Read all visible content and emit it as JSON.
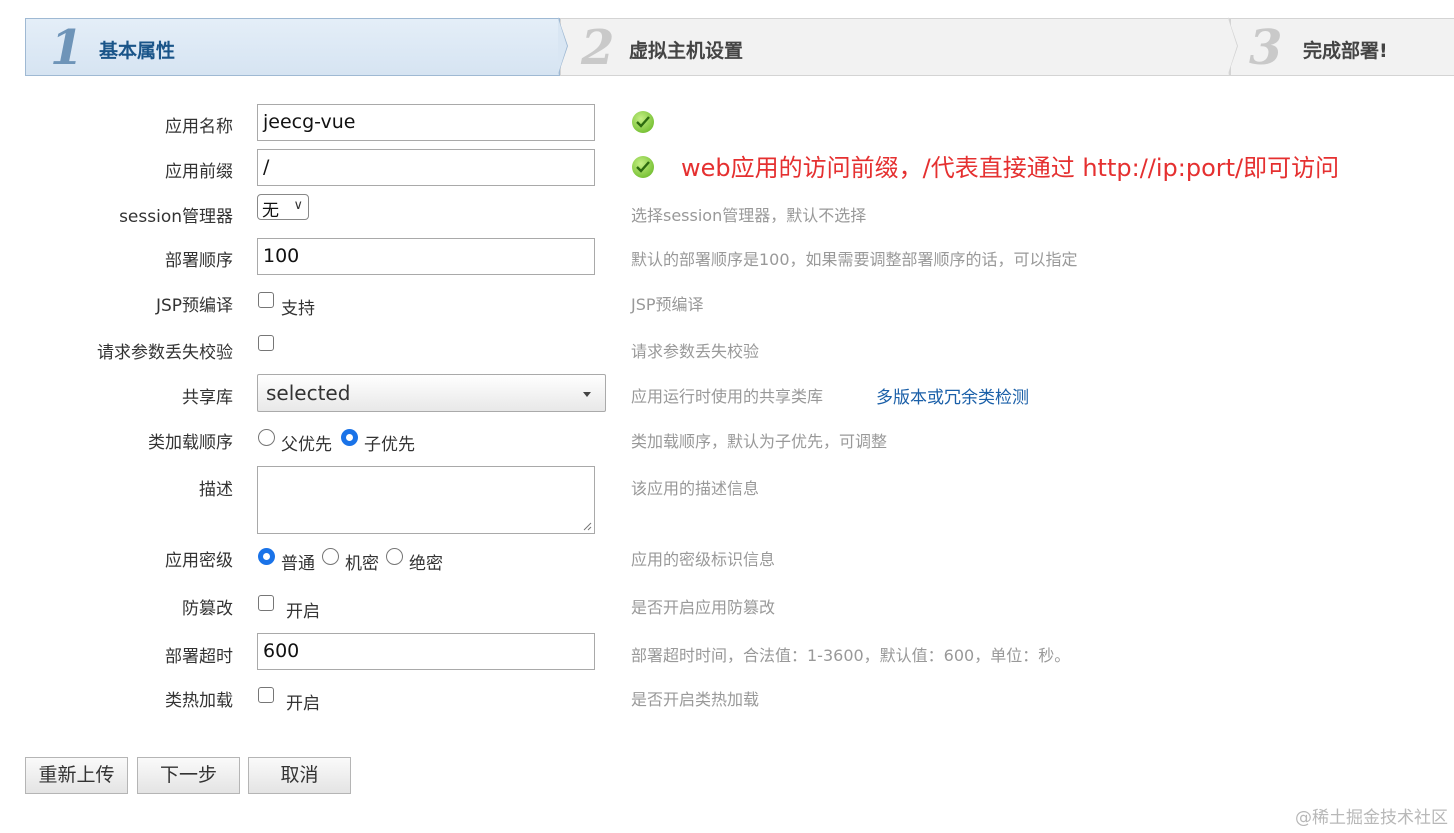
{
  "steps": [
    {
      "num": "1",
      "label": "基本属性"
    },
    {
      "num": "2",
      "label": "虚拟主机设置"
    },
    {
      "num": "3",
      "label": "完成部署!"
    }
  ],
  "form": {
    "app_name": {
      "label": "应用名称",
      "value": "jeecg-vue"
    },
    "app_prefix": {
      "label": "应用前缀",
      "value": "/"
    },
    "session_manager": {
      "label": "session管理器",
      "value": "无",
      "hint": "选择session管理器，默认不选择"
    },
    "deploy_order": {
      "label": "部署顺序",
      "value": "100",
      "hint": "默认的部署顺序是100，如果需要调整部署顺序的话，可以指定"
    },
    "jsp_precompile": {
      "label": "JSP预编译",
      "option": "支持",
      "checked": false,
      "hint": "JSP预编译"
    },
    "param_loss_check": {
      "label": "请求参数丢失校验",
      "checked": false,
      "hint": "请求参数丢失校验"
    },
    "shared_lib": {
      "label": "共享库",
      "value": "selected",
      "hint": "应用运行时使用的共享类库",
      "link": "多版本或冗余类检测"
    },
    "classload_order": {
      "label": "类加载顺序",
      "options": [
        "父优先",
        "子优先"
      ],
      "selected": "子优先",
      "hint": "类加载顺序，默认为子优先，可调整"
    },
    "description": {
      "label": "描述",
      "value": "",
      "hint": "该应用的描述信息"
    },
    "security_level": {
      "label": "应用密级",
      "options": [
        "普通",
        "机密",
        "绝密"
      ],
      "selected": "普通",
      "hint": "应用的密级标识信息"
    },
    "tamper_proof": {
      "label": "防篡改",
      "option": "开启",
      "checked": false,
      "hint": "是否开启应用防篡改"
    },
    "deploy_timeout": {
      "label": "部署超时",
      "value": "600",
      "hint": "部署超时时间，合法值：1-3600，默认值：600，单位：秒。"
    },
    "hot_reload": {
      "label": "类热加载",
      "option": "开启",
      "checked": false,
      "hint": "是否开启类热加载"
    }
  },
  "annotation": "web应用的访问前缀，/代表直接通过 http://ip:port/即可访问",
  "buttons": {
    "reupload": "重新上传",
    "next": "下一步",
    "cancel": "取消"
  },
  "watermark": "@稀土掘金技术社区",
  "colors": {
    "accent": "#1a5589",
    "annotation": "#e53030",
    "radio": "#1a73e8",
    "ok": "#7cc43a"
  }
}
